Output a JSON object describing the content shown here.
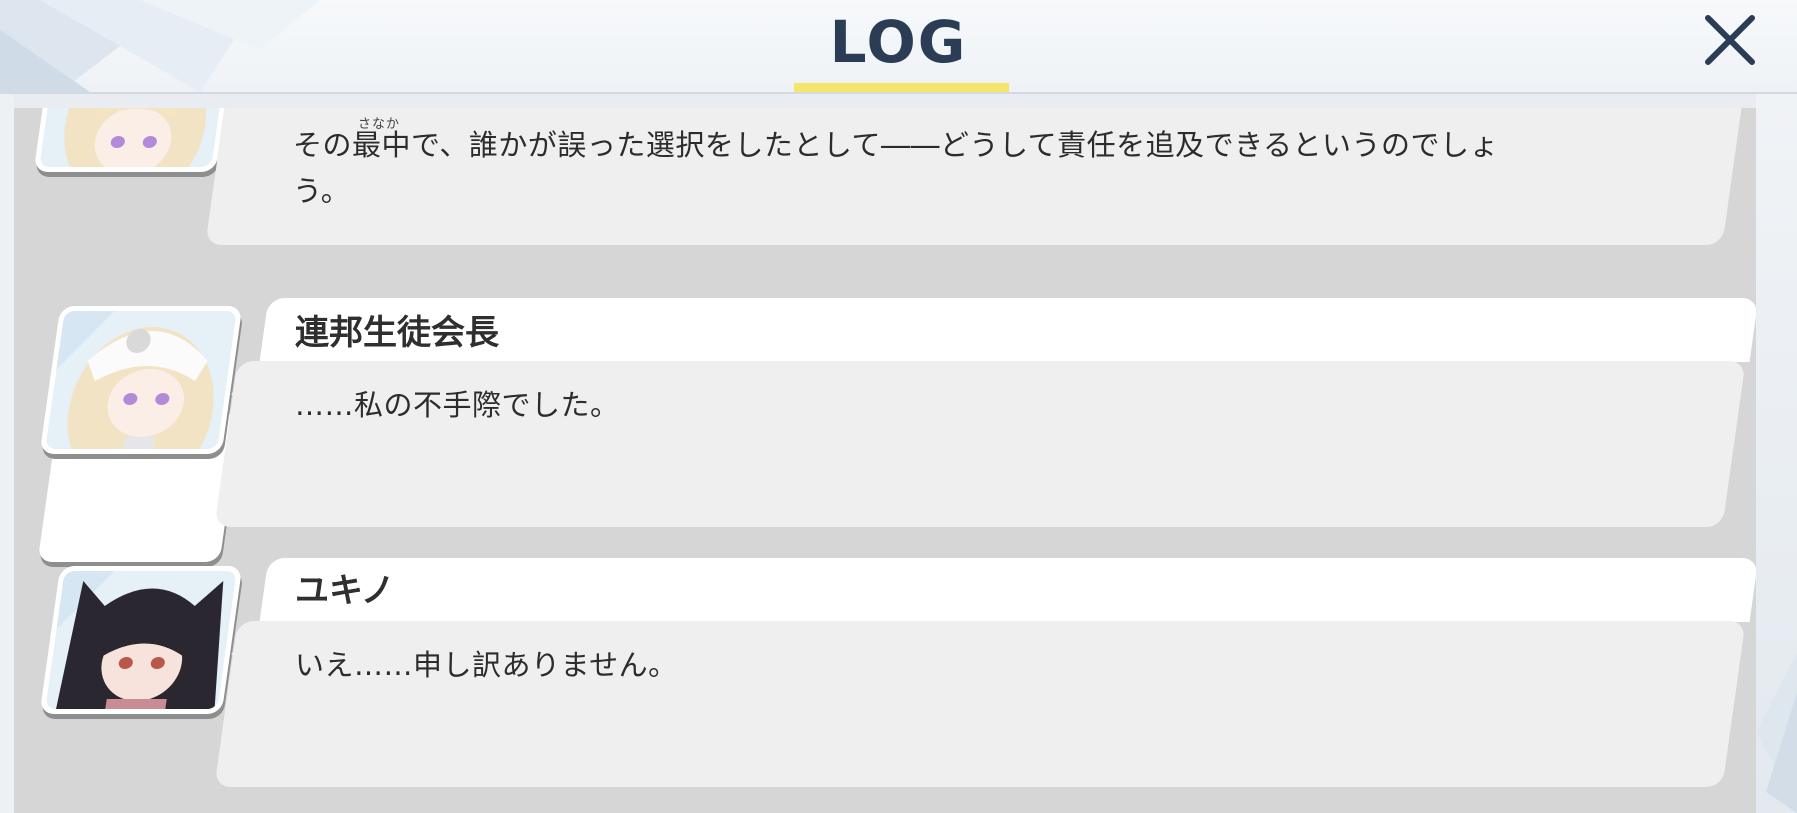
{
  "header": {
    "title": "LOG",
    "close_icon": "close-icon",
    "accent_color": "#f6e56b",
    "title_color": "#2b3c55"
  },
  "log": {
    "entries": [
      {
        "speaker": "",
        "portrait": "white-haired-girl-portrait",
        "ruby": "さなか",
        "message": "その最中で、誰かが誤った選択をしたとして――どうして責任を追及できるというのでしょう。"
      },
      {
        "speaker": "連邦生徒会長",
        "portrait": "white-haired-girl-portrait",
        "message": "……私の不手際でした。"
      },
      {
        "speaker": "ユキノ",
        "portrait": "black-haired-girl-portrait",
        "message": "いえ……申し訳ありません。"
      }
    ]
  }
}
